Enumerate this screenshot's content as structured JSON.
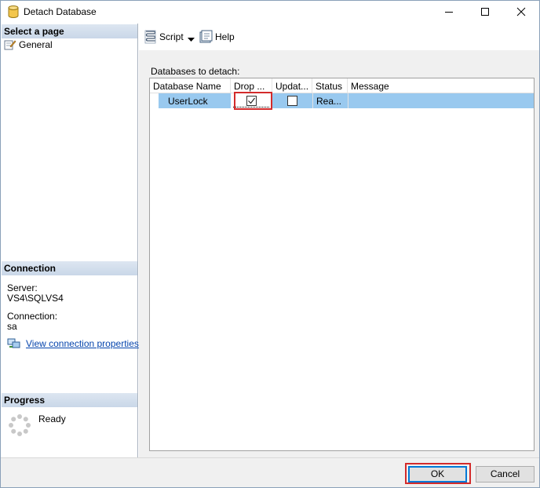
{
  "window": {
    "title": "Detach Database"
  },
  "left": {
    "select_page_header": "Select a page",
    "pages": [
      {
        "label": "General",
        "icon": "wrench-page-icon"
      }
    ],
    "connection_header": "Connection",
    "server_label": "Server:",
    "server_value": "VS4\\SQLVS4",
    "connection_label": "Connection:",
    "connection_value": "sa",
    "view_connection_link": "View connection properties",
    "progress_header": "Progress",
    "progress_status": "Ready"
  },
  "toolbar": {
    "script_label": "Script",
    "help_label": "Help"
  },
  "grid": {
    "label": "Databases to detach:",
    "columns": [
      "Database Name",
      "Drop ...",
      "Updat...",
      "Status",
      "Message"
    ],
    "rows": [
      {
        "name": "UserLock",
        "drop_connections": true,
        "update_statistics": false,
        "status": "Rea...",
        "message": ""
      }
    ]
  },
  "footer": {
    "ok_label": "OK",
    "cancel_label": "Cancel"
  },
  "colors": {
    "selected_row": "#99c9ef",
    "section_header": "#d3dfee",
    "highlight": "#d32b2b",
    "link": "#0645ad"
  }
}
